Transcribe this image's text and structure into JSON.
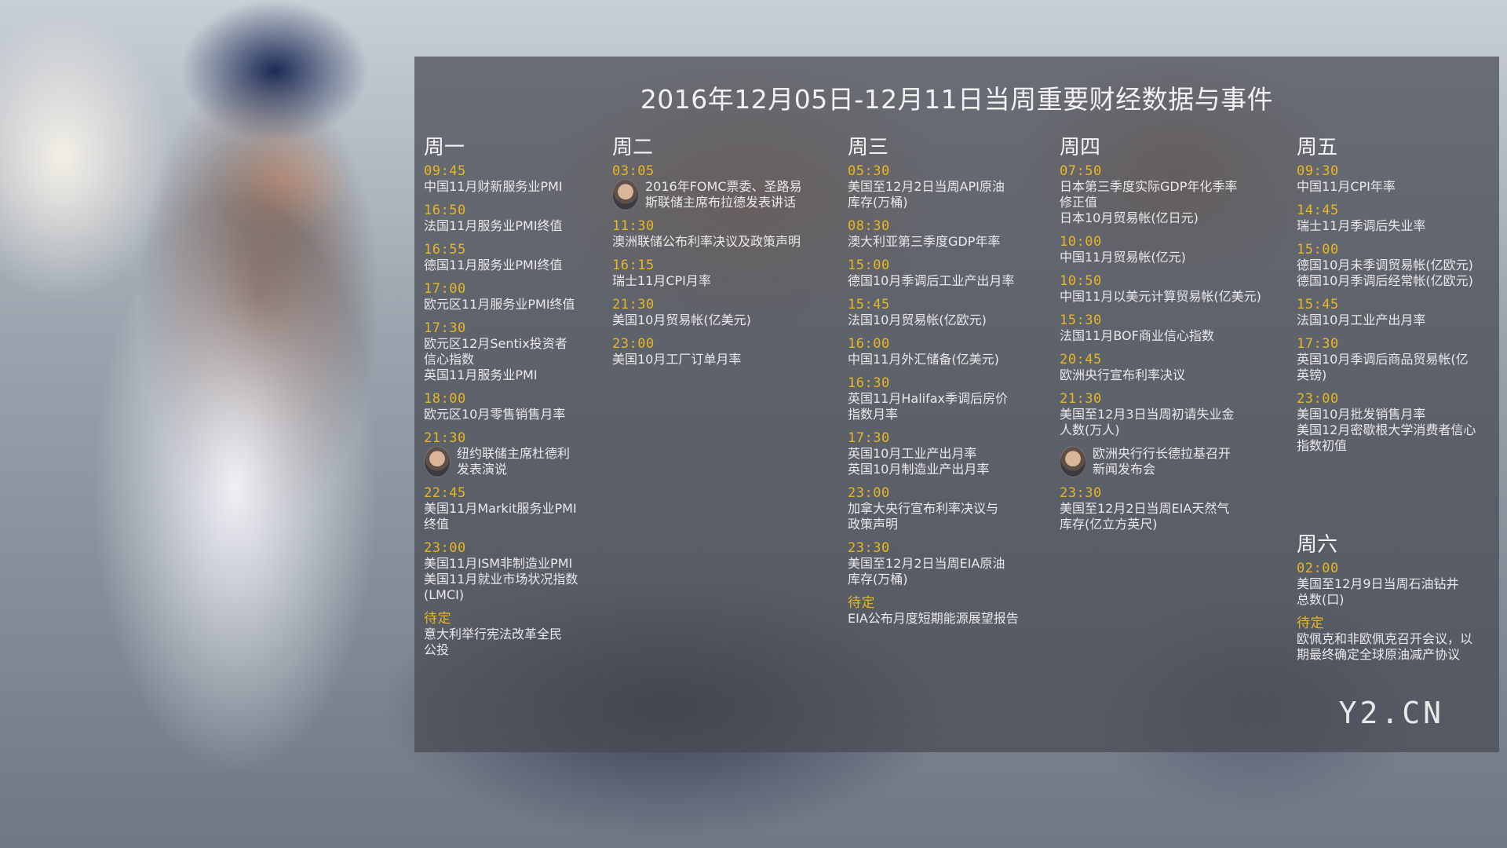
{
  "title": "2016年12月05日-12月11日当周重要财经数据与事件",
  "logo": "Y2.CN",
  "columns": [
    {
      "day": "周一",
      "events": [
        {
          "time": "09:45",
          "lines": [
            "中国11月财新服务业PMI"
          ]
        },
        {
          "time": "16:50",
          "lines": [
            "法国11月服务业PMI终值"
          ]
        },
        {
          "time": "16:55",
          "lines": [
            "德国11月服务业PMI终值"
          ]
        },
        {
          "time": "17:00",
          "lines": [
            "欧元区11月服务业PMI终值"
          ]
        },
        {
          "time": "17:30",
          "lines": [
            "欧元区12月Sentix投资者",
            "信心指数",
            "英国11月服务业PMI"
          ]
        },
        {
          "time": "18:00",
          "lines": [
            "欧元区10月零售销售月率"
          ]
        },
        {
          "time": "21:30",
          "avatar": true,
          "lines": [
            "纽约联储主席杜德利",
            "发表演说"
          ]
        },
        {
          "time": "22:45",
          "lines": [
            "美国11月Markit服务业PMI",
            "终值"
          ]
        },
        {
          "time": "23:00",
          "lines": [
            "美国11月ISM非制造业PMI",
            "美国11月就业市场状况指数",
            "(LMCI)"
          ]
        },
        {
          "time": "待定",
          "lines": [
            "意大利举行宪法改革全民",
            "公投"
          ]
        }
      ]
    },
    {
      "day": "周二",
      "events": [
        {
          "time": "03:05",
          "avatar": true,
          "lines": [
            "2016年FOMC票委、圣路易",
            "斯联储主席布拉德发表讲话"
          ]
        },
        {
          "time": "11:30",
          "lines": [
            "澳洲联储公布利率决议及政策声明"
          ]
        },
        {
          "time": "16:15",
          "lines": [
            "瑞士11月CPI月率"
          ]
        },
        {
          "time": "21:30",
          "lines": [
            "美国10月贸易帐(亿美元)"
          ]
        },
        {
          "time": "23:00",
          "lines": [
            "美国10月工厂订单月率"
          ]
        }
      ]
    },
    {
      "day": "周三",
      "events": [
        {
          "time": "05:30",
          "lines": [
            "美国至12月2日当周API原油",
            "库存(万桶)"
          ]
        },
        {
          "time": "08:30",
          "lines": [
            "澳大利亚第三季度GDP年率"
          ]
        },
        {
          "time": "15:00",
          "lines": [
            "德国10月季调后工业产出月率"
          ]
        },
        {
          "time": "15:45",
          "lines": [
            "法国10月贸易帐(亿欧元)"
          ]
        },
        {
          "time": "16:00",
          "lines": [
            "中国11月外汇储备(亿美元)"
          ]
        },
        {
          "time": "16:30",
          "lines": [
            "英国11月Halifax季调后房价",
            "指数月率"
          ]
        },
        {
          "time": "17:30",
          "lines": [
            "英国10月工业产出月率",
            "英国10月制造业产出月率"
          ]
        },
        {
          "time": "23:00",
          "lines": [
            "加拿大央行宣布利率决议与",
            "政策声明"
          ]
        },
        {
          "time": "23:30",
          "lines": [
            "美国至12月2日当周EIA原油",
            "库存(万桶)"
          ]
        },
        {
          "time": "待定",
          "lines": [
            "EIA公布月度短期能源展望报告"
          ]
        }
      ]
    },
    {
      "day": "周四",
      "events": [
        {
          "time": "07:50",
          "lines": [
            "日本第三季度实际GDP年化季率",
            "修正值",
            "日本10月贸易帐(亿日元)"
          ]
        },
        {
          "time": "10:00",
          "lines": [
            "中国11月贸易帐(亿元)"
          ]
        },
        {
          "time": "10:50",
          "lines": [
            "中国11月以美元计算贸易帐(亿美元)"
          ]
        },
        {
          "time": "15:30",
          "lines": [
            "法国11月BOF商业信心指数"
          ]
        },
        {
          "time": "20:45",
          "lines": [
            "欧洲央行宣布利率决议"
          ]
        },
        {
          "time": "21:30",
          "lines": [
            "美国至12月3日当周初请失业金",
            "人数(万人)"
          ]
        },
        {
          "time": "",
          "avatar": true,
          "lines": [
            "欧洲央行行长德拉基召开",
            "新闻发布会"
          ]
        },
        {
          "time": "23:30",
          "lines": [
            "美国至12月2日当周EIA天然气",
            "库存(亿立方英尺)"
          ]
        }
      ]
    },
    {
      "day": "周五",
      "events": [
        {
          "time": "09:30",
          "lines": [
            "中国11月CPI年率"
          ]
        },
        {
          "time": "14:45",
          "lines": [
            "瑞士11月季调后失业率"
          ]
        },
        {
          "time": "15:00",
          "lines": [
            "德国10月未季调贸易帐(亿欧元)",
            "德国10月季调后经常帐(亿欧元)"
          ]
        },
        {
          "time": "15:45",
          "lines": [
            "法国10月工业产出月率"
          ]
        },
        {
          "time": "17:30",
          "lines": [
            "英国10月季调后商品贸易帐(亿",
            "英镑)"
          ]
        },
        {
          "time": "23:00",
          "lines": [
            "美国10月批发销售月率",
            "美国12月密歇根大学消费者信心",
            "指数初值"
          ]
        }
      ]
    },
    {
      "day": "周六",
      "events": [
        {
          "time": "02:00",
          "lines": [
            "美国至12月9日当周石油钻井",
            "总数(口)"
          ]
        },
        {
          "time": "待定",
          "lines": [
            "欧佩克和非欧佩克召开会议，以",
            "期最终确定全球原油减产协议"
          ]
        }
      ]
    }
  ]
}
